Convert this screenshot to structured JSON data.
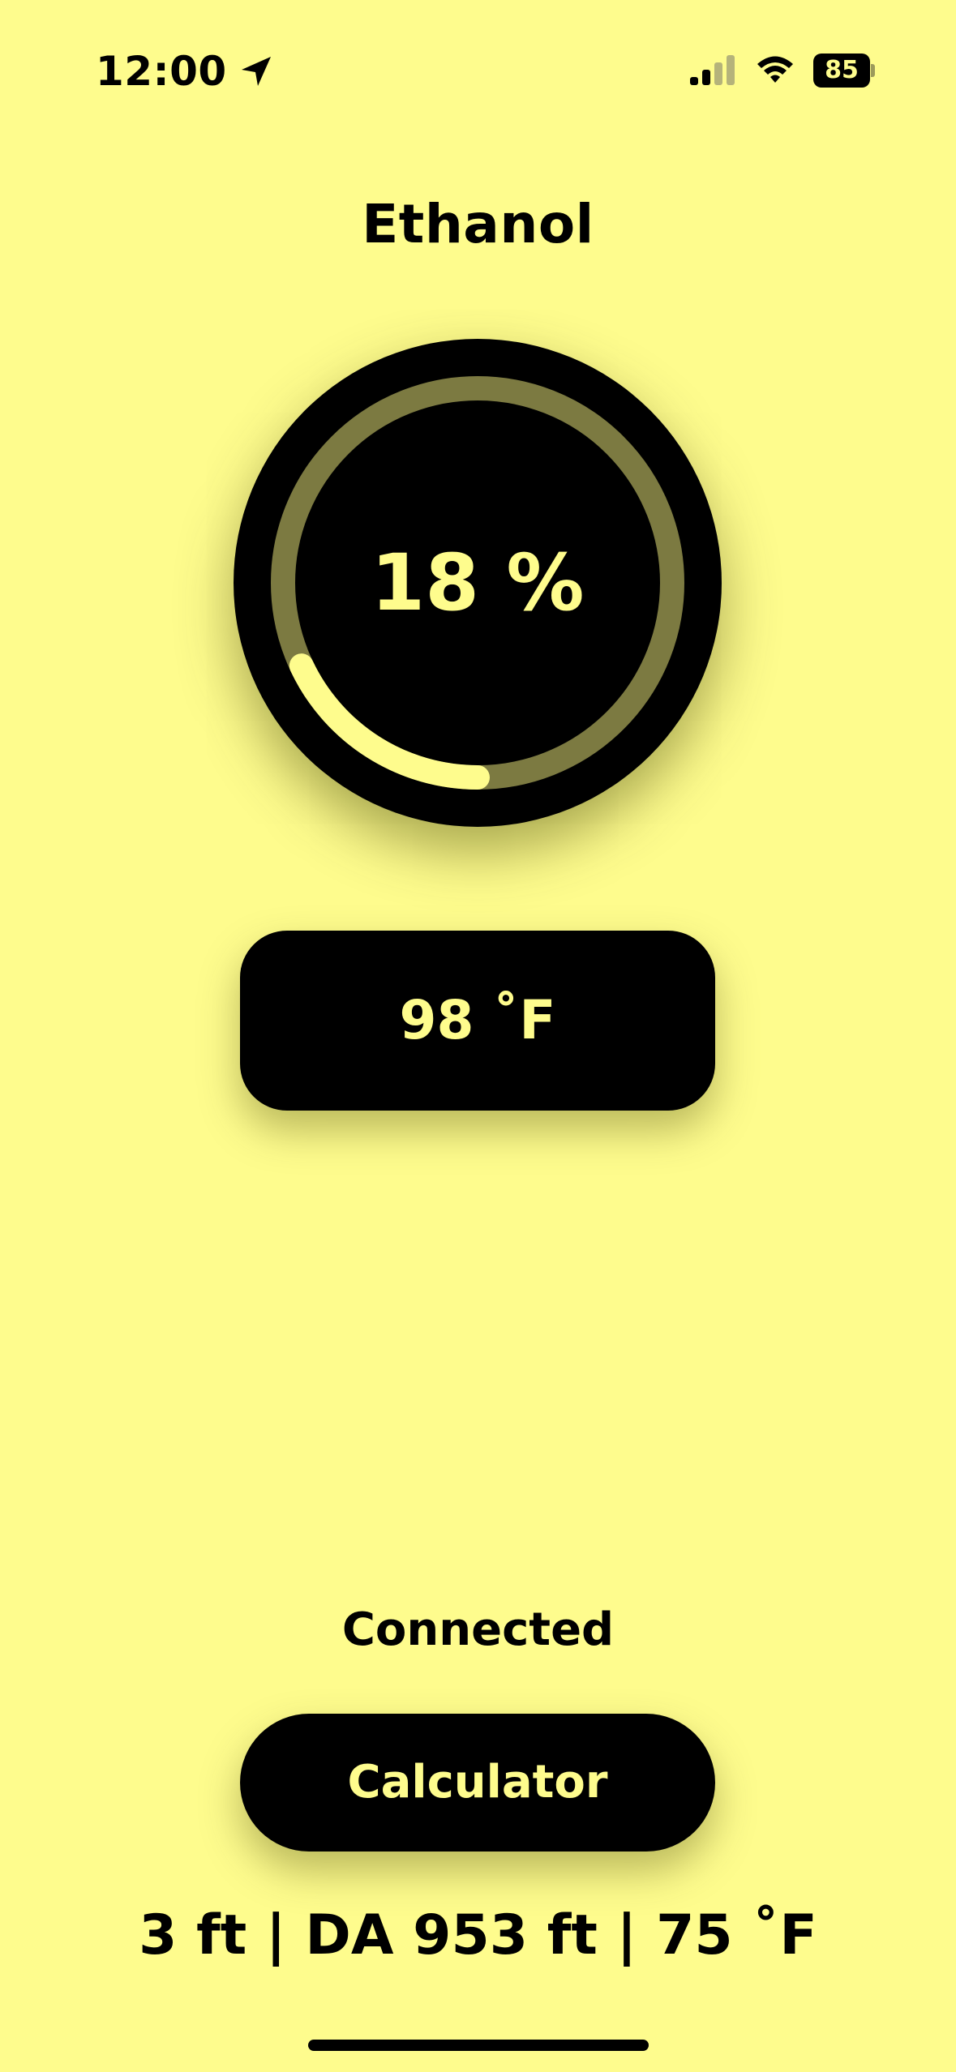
{
  "colors": {
    "background": "#fefc8d",
    "accent": "#fefc8d",
    "track": "#7c7a41",
    "panel": "#000000"
  },
  "status_bar": {
    "time": "12:00",
    "battery_level": "85",
    "signal_bars_active": 2,
    "signal_bars_total": 4,
    "icons": [
      "location-arrow-icon",
      "cellular-signal-icon",
      "wifi-icon",
      "battery-icon"
    ]
  },
  "title": "Ethanol",
  "gauge": {
    "label": "18 %",
    "progress_fraction": 0.18
  },
  "temperature": {
    "label": "98 ˚F"
  },
  "connection": {
    "status": "Connected"
  },
  "calculator_button": {
    "label": "Calculator"
  },
  "footer": {
    "info": "3 ft | DA 953 ft | 75 ˚F"
  }
}
